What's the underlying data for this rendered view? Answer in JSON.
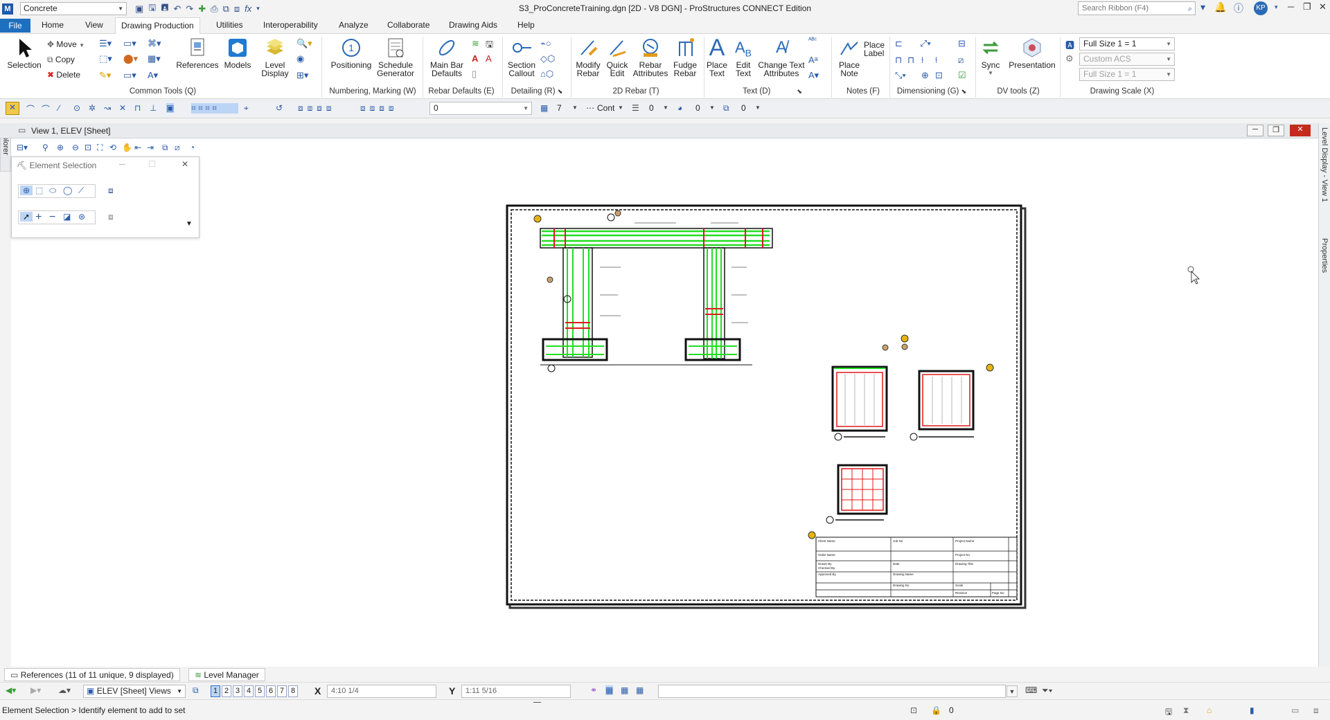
{
  "titlebar": {
    "app_logo": "M",
    "workflow": "Concrete",
    "qat_icons": [
      "view-icon",
      "save-icon",
      "save-settings-icon",
      "undo-icon",
      "redo-icon",
      "pin-icon",
      "print-icon",
      "compare-icon",
      "models-icon",
      "fx-icon",
      "customize-icon"
    ],
    "doc_title": "S3_ProConcreteTraining.dgn [2D - V8 DGN] - ProStructures CONNECT Edition",
    "search_placeholder": "Search Ribbon (F4)",
    "user_initials": "KP"
  },
  "tabs": [
    "File",
    "Home",
    "View",
    "Drawing Production",
    "Utilities",
    "Interoperability",
    "Analyze",
    "Collaborate",
    "Drawing Aids",
    "Help"
  ],
  "ribbon": {
    "common_tools": {
      "label": "Common Tools (Q)",
      "selection": "Selection",
      "move": "Move",
      "copy": "Copy",
      "delete": "Delete",
      "references": "References",
      "models": "Models",
      "level_display": "Level\nDisplay"
    },
    "numbering": {
      "label": "Numbering, Marking (W)",
      "positioning": "Positioning",
      "schedule": "Schedule\nGenerator"
    },
    "rebar_defaults": {
      "label": "Rebar Defaults (E)",
      "main_bar": "Main Bar\nDefaults"
    },
    "detailing": {
      "label": "Detailing (R)",
      "section_callout": "Section\nCallout"
    },
    "rebar_2d": {
      "label": "2D Rebar (T)",
      "modify": "Modify\nRebar",
      "quick_edit": "Quick\nEdit",
      "attributes": "Rebar\nAttributes",
      "fudge": "Fudge\nRebar"
    },
    "text": {
      "label": "Text (D)",
      "place_text": "Place\nText",
      "edit_text": "Edit\nText",
      "change_attr": "Change Text\nAttributes"
    },
    "notes": {
      "label": "Notes (F)",
      "place_label": "Place\nLabel",
      "place_note": "Place\nNote"
    },
    "dimensioning": {
      "label": "Dimensioning (G)"
    },
    "dv_tools": {
      "label": "DV tools (Z)",
      "sync": "Sync",
      "presentation": "Presentation"
    },
    "drawing_scale": {
      "label": "Drawing Scale (X)",
      "scale": "Full Size 1 = 1",
      "acs": "Custom ACS",
      "scale2": "Full Size 1 = 1"
    }
  },
  "attributes": {
    "level": "0",
    "color": "7",
    "style": "Cont",
    "weight": "0",
    "transparency": "0",
    "priority": "0"
  },
  "view": {
    "title": "View 1, ELEV [Sheet]",
    "explorer": "Explorer",
    "right_rail": [
      "Level Display - View 1",
      "Properties"
    ]
  },
  "element_selection": {
    "title": "Element Selection"
  },
  "title_block": {
    "client": "Client Name",
    "job": "Job No",
    "project": "Project Name",
    "order": "Order Name",
    "project_no": "Project No",
    "drawn_by": "Drawn By",
    "checked_by": "Checked By",
    "approved_by": "Approved By",
    "date": "Date",
    "drawing_title": "Drawing Title",
    "drawing_name": "Drawing Name",
    "drawing_no": "Drawing No",
    "scale": "Scale",
    "revision": "Revision",
    "page": "Page No"
  },
  "dock_tabs": {
    "references": "References (11 of 11 unique, 9 displayed)",
    "level_manager": "Level Manager"
  },
  "status": {
    "views_label": "ELEV [Sheet] Views",
    "view_numbers": [
      "1",
      "2",
      "3",
      "4",
      "5",
      "6",
      "7",
      "8"
    ],
    "x_label": "X",
    "x_value": "4:10 1/4",
    "y_label": "Y",
    "y_value": "1:11 5/16",
    "prompt": "Element Selection > Identify element to add to set",
    "lock_count": "0"
  }
}
